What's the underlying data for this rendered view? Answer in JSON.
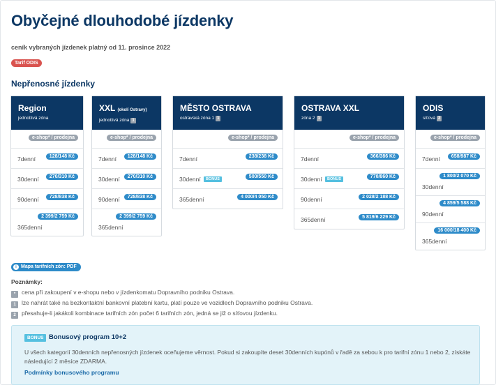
{
  "title": "Obyčejné dlouhodobé jízdenky",
  "subtitle": "ceník vybraných jízdenek platný od 11. prosince 2022",
  "tariff_badge": "Tarif ODIS",
  "section_title": "Nepřenosné jízdenky",
  "channel_label": "e-shop* / prodejna",
  "bonus_tag": "BONUS",
  "cards": [
    {
      "name": "Region",
      "name_small": "",
      "sub": "jednotlivá zóna",
      "zone_num": "",
      "rows": [
        {
          "label": "7denní",
          "price": "128/148 Kč"
        },
        {
          "label": "30denní",
          "price": "270/310 Kč"
        },
        {
          "label": "90denní",
          "price": "728/838 Kč"
        },
        {
          "label": "365denní",
          "price": "2 399/2 759 Kč"
        }
      ]
    },
    {
      "name": "XXL",
      "name_small": "(okolí Ostravy)",
      "sub": "jednotlivá zóna",
      "zone_num": "1",
      "rows": [
        {
          "label": "7denní",
          "price": "128/148 Kč"
        },
        {
          "label": "30denní",
          "price": "270/310 Kč"
        },
        {
          "label": "90denní",
          "price": "728/838 Kč"
        },
        {
          "label": "365denní",
          "price": "2 399/2 759 Kč"
        }
      ]
    },
    {
      "name": "MĚSTO OSTRAVA",
      "name_small": "",
      "sub": "ostravská zóna 1",
      "zone_num": "1",
      "rows": [
        {
          "label": "7denní",
          "price": "238/238 Kč"
        },
        {
          "label": "30denní",
          "price": "500/550 Kč",
          "bonus": true
        },
        {
          "label": "365denní",
          "price": "4 000/4 050 Kč"
        }
      ]
    },
    {
      "name": "OSTRAVA XXL",
      "name_small": "",
      "sub": "zóna 2",
      "zone_num": "1",
      "rows": [
        {
          "label": "7denní",
          "price": "366/386 Kč"
        },
        {
          "label": "30denní",
          "price": "770/860 Kč",
          "bonus": true
        },
        {
          "label": "90denní",
          "price": "2 028/2 188 Kč"
        },
        {
          "label": "365denní",
          "price": "5 819/6 229 Kč"
        }
      ]
    },
    {
      "name": "ODIS",
      "name_small": "",
      "sub": "síťová",
      "zone_num": "2",
      "rows": [
        {
          "label": "7denní",
          "price": "658/987 Kč"
        },
        {
          "label": "30denní",
          "price": "1 800/2 070 Kč"
        },
        {
          "label": "90denní",
          "price": "4 859/5 588 Kč"
        },
        {
          "label": "365denní",
          "price": "16 000/18 400 Kč"
        }
      ]
    }
  ],
  "map_link": "Mapa tarifních zón: PDF",
  "notes_title": "Poznámky:",
  "notes": [
    {
      "mark": "*",
      "text": "cena při zakoupení v e-shopu nebo v jízdenkomatu Dopravního podniku Ostrava."
    },
    {
      "mark": "1",
      "text": "lze nahrát také na bezkontaktní bankovní platební kartu, platí pouze ve vozidlech Dopravního podniku Ostrava."
    },
    {
      "mark": "2",
      "text": "přesahuje-li jakákoli kombinace tarifních zón počet 6 tarifních zón, jedná se již o síťovou jízdenku."
    }
  ],
  "bonus_box": {
    "badge": "BONUS",
    "title": "Bonusový program 10+2",
    "text": "U všech kategorií 30denních nepřenosných jízdenek oceňujeme věrnost. Pokud si zakoupíte deset 30denních kupónů v řadě za sebou k pro tarifní zónu 1 nebo 2, získáte následující 2 měsíce ZDARMA.",
    "link": "Podmínky bonusového programu"
  }
}
